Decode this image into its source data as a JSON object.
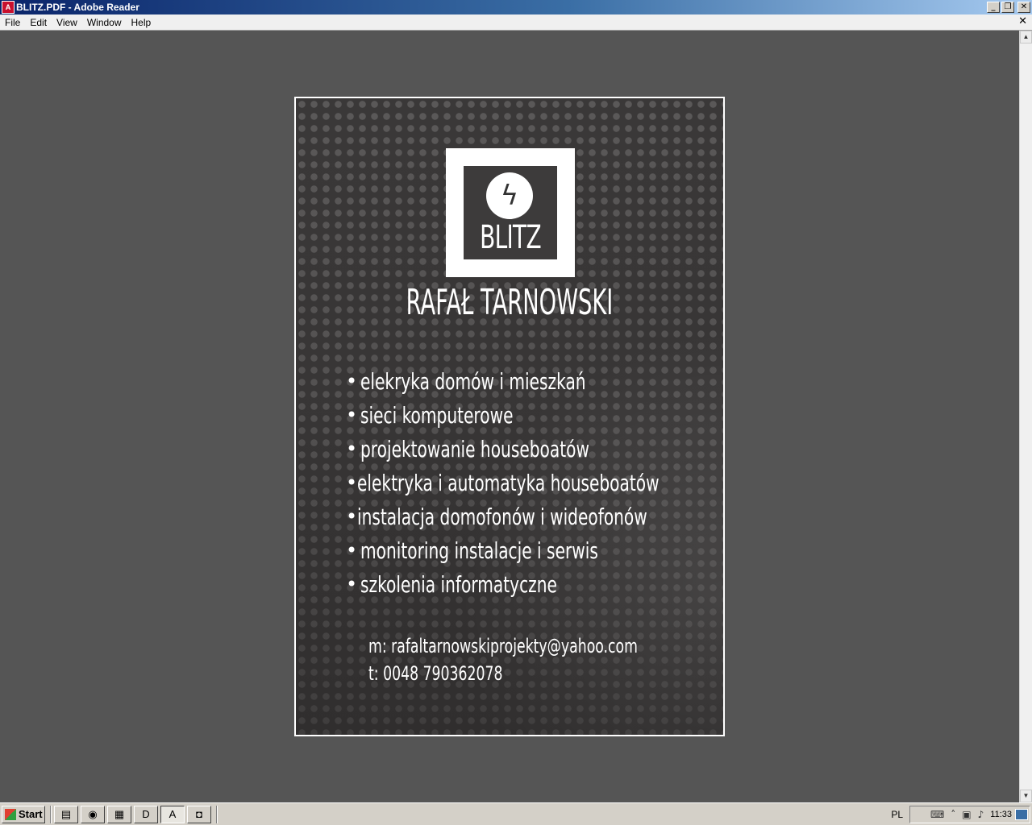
{
  "window": {
    "title": "BLITZ.PDF - Adobe Reader",
    "app_icon_glyph": "A",
    "minimize": "_",
    "restore": "❐",
    "close": "✕"
  },
  "menu": {
    "items": [
      "File",
      "Edit",
      "View",
      "Window",
      "Help"
    ],
    "close_doc": "✕"
  },
  "scrollbar": {
    "up": "▲",
    "down": "▼"
  },
  "page": {
    "logo_symbol": "ϟ",
    "logo_text": "BLITZ",
    "name": "RAFAŁ TARNOWSKI",
    "bullet": "•",
    "services": [
      "elekryka domów i mieszkań",
      "sieci komputerowe",
      "projektowanie houseboatów",
      "elektryka i  automatyka houseboatów",
      "instalacja domofonów i wideofonów",
      "monitoring instalacje i serwis",
      "szkolenia informatyczne"
    ],
    "email": "m: rafaltarnowskiprojekty@yahoo.com",
    "phone": "t: 0048 790362078",
    "colors": {
      "background": "#3a3838",
      "text": "#ffffff",
      "frame": "#ffffff"
    }
  },
  "taskbar": {
    "start_label": "Start",
    "quick_launch": [
      {
        "icon": "folder-icon",
        "glyph": "▤"
      },
      {
        "icon": "firefox-icon",
        "glyph": "◉"
      },
      {
        "icon": "document-icon",
        "glyph": "▦"
      },
      {
        "icon": "d-app-icon",
        "glyph": "D"
      },
      {
        "icon": "adobe-reader-icon",
        "glyph": "A"
      },
      {
        "icon": "app-icon",
        "glyph": "◘"
      }
    ],
    "language": "PL",
    "tray_icons": {
      "keyboard": "⌨",
      "expand": "˄",
      "network": "▣",
      "volume": "♪"
    },
    "clock": "11:33"
  }
}
